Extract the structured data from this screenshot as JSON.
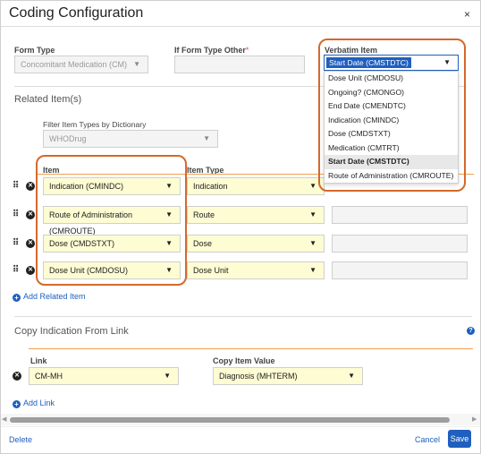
{
  "dialog": {
    "title": "Coding Configuration",
    "close_icon": "×"
  },
  "form_type": {
    "label": "Form Type",
    "value": "Concomitant Medication (CM)"
  },
  "form_type_other": {
    "label": "If Form Type Other",
    "required_mark": "*",
    "value": ""
  },
  "verbatim_item": {
    "label": "Verbatim Item",
    "value": "Start Date (CMSTDTC)",
    "options": [
      "Dose Unit (CMDOSU)",
      "Ongoing? (CMONGO)",
      "End Date (CMENDTC)",
      "Indication (CMINDC)",
      "Dose (CMDSTXT)",
      "Medication (CMTRT)",
      "Start Date (CMSTDTC)",
      "Route of Administration (CMROUTE)"
    ],
    "selected_option": "Start Date (CMSTDTC)"
  },
  "related_items": {
    "section_title": "Related Item(s)",
    "filter_label": "Filter Item Types by Dictionary",
    "filter_value": "WHODrug",
    "item_header": "Item",
    "item_type_header": "Item Type",
    "rows": [
      {
        "item": "Indication (CMINDC)",
        "item_type": "Indication"
      },
      {
        "item": "Route of Administration (CMROUTE)",
        "item_type": "Route"
      },
      {
        "item": "Dose (CMDSTXT)",
        "item_type": "Dose"
      },
      {
        "item": "Dose Unit (CMDOSU)",
        "item_type": "Dose Unit"
      }
    ],
    "add_label": "Add Related Item"
  },
  "copy_indication": {
    "section_title": "Copy Indication From Link",
    "link_header": "Link",
    "copy_value_header": "Copy Item Value",
    "rows": [
      {
        "link": "CM-MH",
        "copy_value": "Diagnosis (MHTERM)"
      }
    ],
    "add_label": "Add Link",
    "help_icon": "?"
  },
  "footer": {
    "delete_label": "Delete",
    "cancel_label": "Cancel",
    "save_label": "Save"
  },
  "icons": {
    "caret": "▼",
    "grip": "⠿",
    "remove": "✕",
    "plus": "+",
    "scroll_left": "◀",
    "scroll_right": "▶"
  },
  "colors": {
    "accent": "#1f5fbf",
    "highlight": "#d4692a",
    "field_yellow": "#fdfcd3",
    "divider_orange": "#f0a050"
  }
}
